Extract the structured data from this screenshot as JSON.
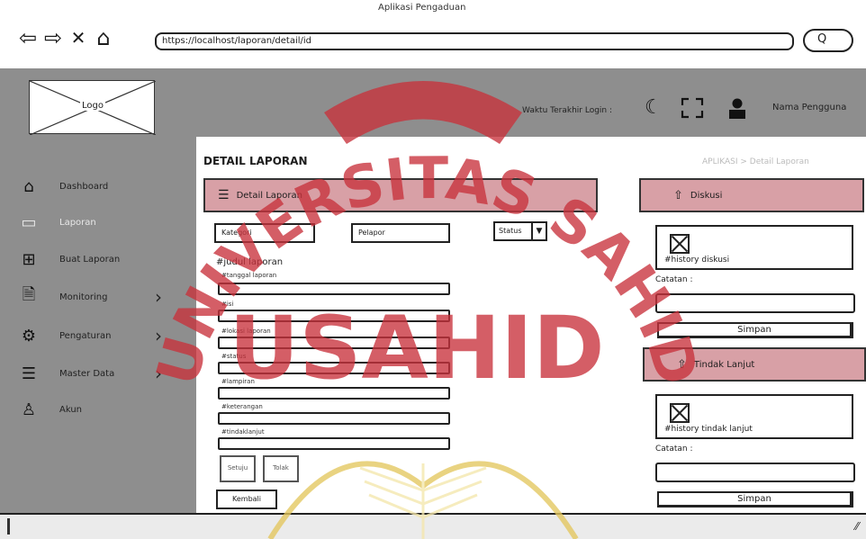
{
  "window": {
    "title": "Aplikasi Pengaduan"
  },
  "browser": {
    "url": "https://localhost/laporan/detail/id",
    "search_icon_glyph": "Q",
    "nav_icons": [
      "back-arrow-icon",
      "forward-arrow-icon",
      "close-icon",
      "home-icon"
    ]
  },
  "header": {
    "logo_text": "Logo",
    "login_time": "Waktu Terakhir Login :",
    "icons": [
      "moon-icon",
      "fullscreen-icon",
      "user-icon"
    ],
    "user_name": "Nama Pengguna"
  },
  "sidebar": {
    "items": [
      {
        "label": "Dashboard",
        "icon": "home-icon",
        "active": false,
        "chevron": false
      },
      {
        "label": "Laporan",
        "icon": "monitor-icon",
        "active": true,
        "chevron": false
      },
      {
        "label": "Buat Laporan",
        "icon": "plus-box-icon",
        "active": false,
        "chevron": false
      },
      {
        "label": "Monitoring",
        "icon": "document-icon",
        "active": false,
        "chevron": true
      },
      {
        "label": "Pengaturan",
        "icon": "gear-icon",
        "active": false,
        "chevron": true
      },
      {
        "label": "Master Data",
        "icon": "database-icon",
        "active": false,
        "chevron": true
      },
      {
        "label": "Akun",
        "icon": "person-icon",
        "active": false,
        "chevron": false
      }
    ]
  },
  "main": {
    "title": "DETAIL LAPORAN",
    "breadcrumb": "APLIKASI > Detail Laporan",
    "detail_header": "Detail Laporan",
    "filters": {
      "left": "Kategori",
      "middle": "Pelapor",
      "status": "Status"
    },
    "judul": "#judul laporan",
    "fields": [
      "#tanggal laporan",
      "#isi",
      "#lokasi laporan",
      "#status",
      "#lampiran",
      "#keterangan",
      "#tindaklanjut"
    ],
    "small_buttons": [
      "Setuju",
      "Tolak"
    ],
    "back_button": "Kembali"
  },
  "right": {
    "diskusi_header": "Diskusi",
    "history_diskusi": "#history diskusi",
    "catatan_label": "Catatan :",
    "simpan_label": "Simpan",
    "tindak_header": "Tindak Lanjut",
    "history_tindak": "#history tindak lanjut",
    "catatan2_label": "Catatan :",
    "simpan2_label": "Simpan"
  },
  "watermark": {
    "text": "UNIVERSITAS SAHID",
    "word": "USAHID",
    "color": "#c8323c"
  }
}
